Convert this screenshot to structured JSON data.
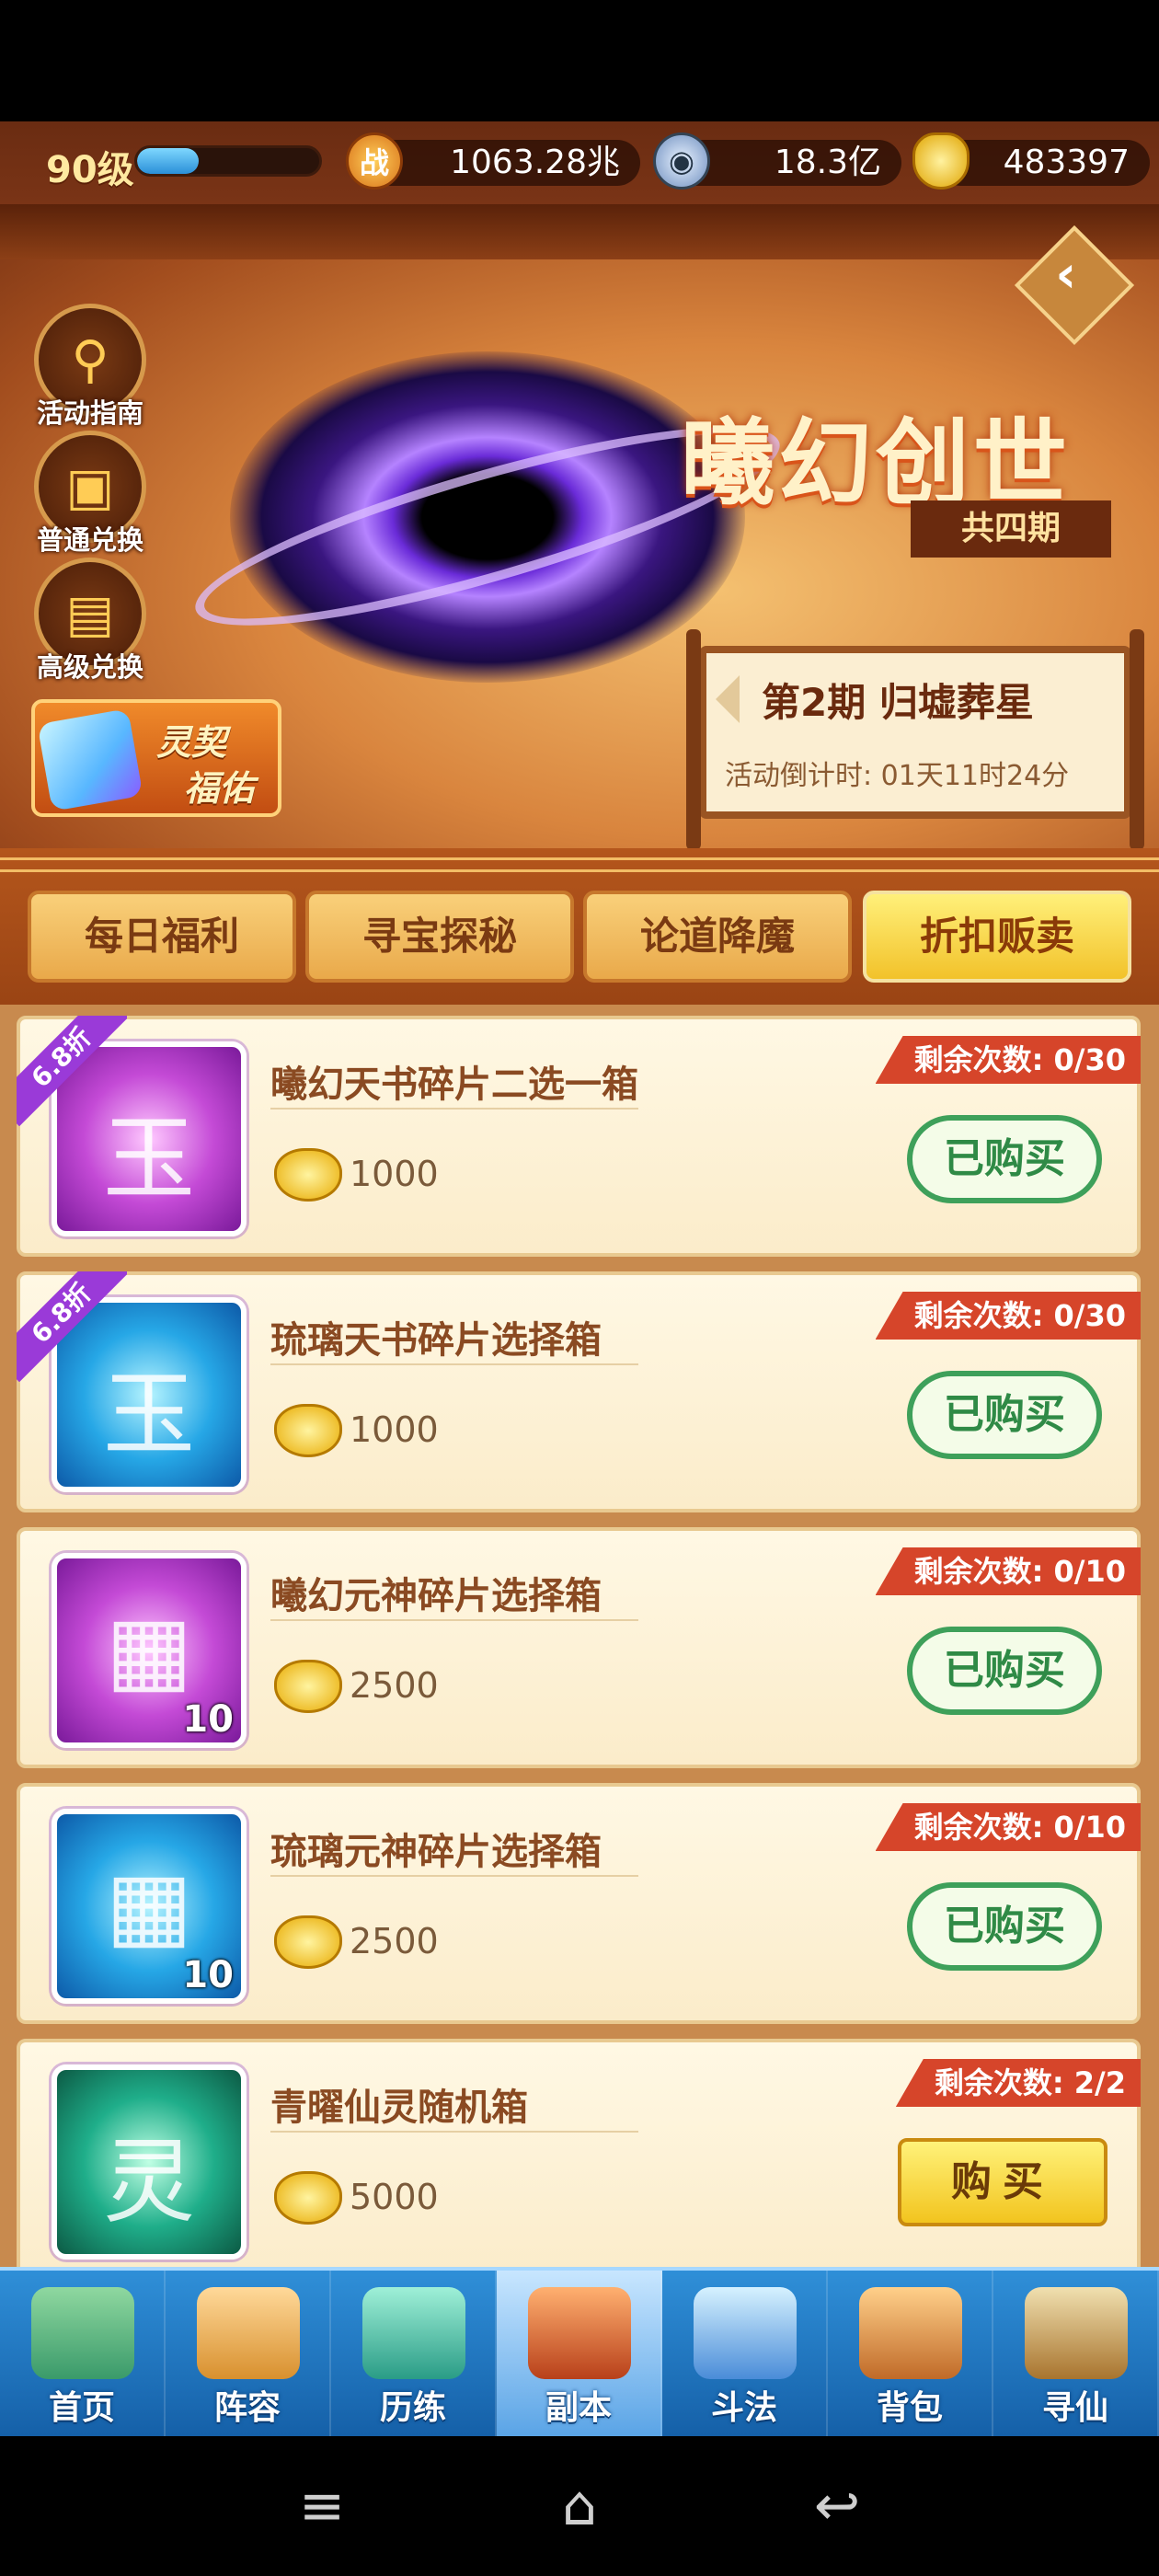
{
  "topbar": {
    "level": "90级",
    "exp_fraction": 0.34,
    "power_icon_text": "战",
    "power": "1063.28兆",
    "coin_value": "18.3亿",
    "gold_value": "483397"
  },
  "banner": {
    "title": "曦幻创世",
    "subtitle": "共四期",
    "period_title": "第2期  归墟葬星",
    "countdown": "活动倒计时: 01天11时24分",
    "side_buttons": [
      "活动指南",
      "普通兑换",
      "高级兑换"
    ],
    "lingqi_line1": "灵契",
    "lingqi_line2": "福佑"
  },
  "tabs": [
    "每日福利",
    "寻宝探秘",
    "论道降魔",
    "折扣贩卖"
  ],
  "items": [
    {
      "name": "曦幻天书碎片二选一箱",
      "price": "1000",
      "remain": "剩余次数: 0/30",
      "button": "已购买",
      "discount": "6.8折",
      "qty": "",
      "color": "purple",
      "symbol": "玉"
    },
    {
      "name": "琉璃天书碎片选择箱",
      "price": "1000",
      "remain": "剩余次数: 0/30",
      "button": "已购买",
      "discount": "6.8折",
      "qty": "",
      "color": "blue",
      "symbol": "玉"
    },
    {
      "name": "曦幻元神碎片选择箱",
      "price": "2500",
      "remain": "剩余次数: 0/10",
      "button": "已购买",
      "discount": "",
      "qty": "10",
      "color": "purple",
      "symbol": ""
    },
    {
      "name": "琉璃元神碎片选择箱",
      "price": "2500",
      "remain": "剩余次数: 0/10",
      "button": "已购买",
      "discount": "",
      "qty": "10",
      "color": "blue",
      "symbol": ""
    },
    {
      "name": "青曜仙灵随机箱",
      "price": "5000",
      "remain": "剩余次数: 2/2",
      "button": "购买",
      "discount": "",
      "qty": "",
      "color": "green",
      "symbol": "灵"
    }
  ],
  "bottom_nav": [
    "首页",
    "阵容",
    "历练",
    "副本",
    "斗法",
    "背包",
    "寻仙"
  ],
  "colors": {
    "accent": "#f2c22a",
    "bought_green": "#3ea05a",
    "remain_red": "#d6452a"
  }
}
